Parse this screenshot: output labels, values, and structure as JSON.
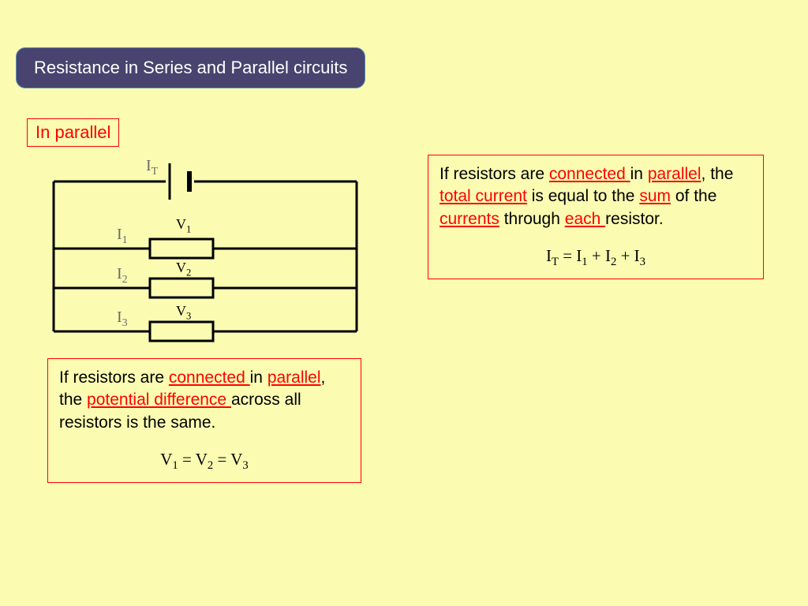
{
  "title": "Resistance in Series and Parallel circuits",
  "subheading": "In parallel",
  "circuit": {
    "labels": {
      "it": "I",
      "it_sub": "T",
      "i1": "I",
      "i1_sub": "1",
      "i2": "I",
      "i2_sub": "2",
      "i3": "I",
      "i3_sub": "3"
    },
    "vlabels": {
      "v1": "V",
      "v1_sub": "1",
      "v2": "V",
      "v2_sub": "2",
      "v3": "V",
      "v3_sub": "3"
    }
  },
  "box_right": {
    "p1a": "If resistors are ",
    "hl1": "connected ",
    "p1b": "in ",
    "hl2": "parallel",
    "p1c": ", the ",
    "hl3": "total current",
    "p1d": " is equal to the ",
    "hl4": "sum",
    "p1e": " of the ",
    "hl5": "currents",
    "p1f": " through ",
    "hl6": "each ",
    "p1g": "resistor.",
    "eq_pre": "I",
    "eq_t": "T",
    "eq_mid1": "  =  I",
    "eq_s1": "1",
    "eq_mid2": "  +  I",
    "eq_s2": "2",
    "eq_mid3": "  +  I",
    "eq_s3": "3"
  },
  "box_left": {
    "p1a": "If resistors are ",
    "hl1": "connected ",
    "p1b": "in ",
    "hl2": "parallel",
    "p1c": ", the ",
    "hl3": "potential difference ",
    "p1d": "across all resistors is the same.",
    "eq_pre": "V",
    "eq_s1": "1",
    "eq_mid1": "  =  V",
    "eq_s2": "2",
    "eq_mid2": "  =  V",
    "eq_s3": "3"
  }
}
